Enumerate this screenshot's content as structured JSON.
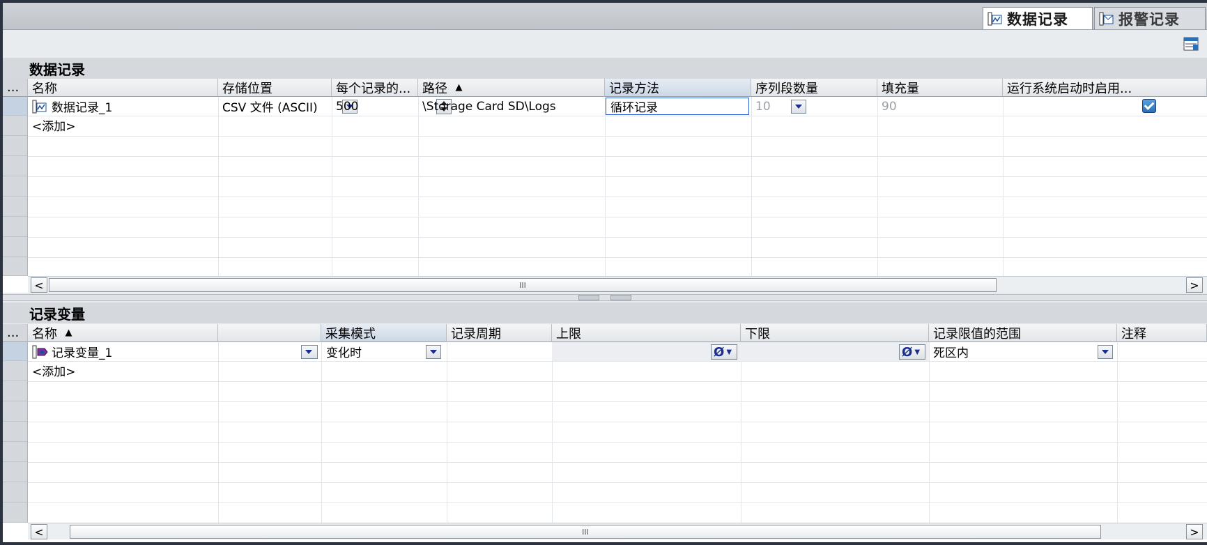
{
  "tabs": [
    {
      "label": "数据记录",
      "icon": "data-log-icon",
      "active": true
    },
    {
      "label": "报警记录",
      "icon": "alarm-log-icon",
      "active": false
    }
  ],
  "data_logs": {
    "title": "数据记录",
    "columns": [
      "...",
      "名称",
      "存储位置",
      "每个记录的...",
      "路径",
      "记录方法",
      "序列段数量",
      "填充量",
      "运行系统启动时启用..."
    ],
    "sort_indicator": "▲",
    "rows": [
      {
        "name": "数据记录_1",
        "storage": "CSV 文件 (ASCII)",
        "records": "500",
        "path": "\\Storage Card SD\\Logs",
        "method": "循环记录",
        "segments": "10",
        "fill": "90",
        "enable_on_start": true
      }
    ],
    "add_row": "<添加>",
    "scroll_thumb": "III"
  },
  "logging_tags": {
    "title": "记录变量",
    "columns": [
      "...",
      "名称",
      "",
      "采集模式",
      "记录周期",
      "上限",
      "下限",
      "记录限值的范围",
      "注释"
    ],
    "sort_indicator": "▲",
    "rows": [
      {
        "name": "记录变量_1",
        "tag_button": "...",
        "mode": "变化时",
        "cycle": "",
        "high": "",
        "low": "",
        "null_symbol": "Ø",
        "range": "死区内",
        "comment": ""
      }
    ],
    "add_row": "<添加>",
    "scroll_thumb": "III"
  },
  "scroll": {
    "left": "<",
    "right": ">"
  },
  "colors": {
    "accent": "#1a2e8c",
    "checkbox": "#2a6fb8",
    "header_bg": "#d5d9de"
  }
}
